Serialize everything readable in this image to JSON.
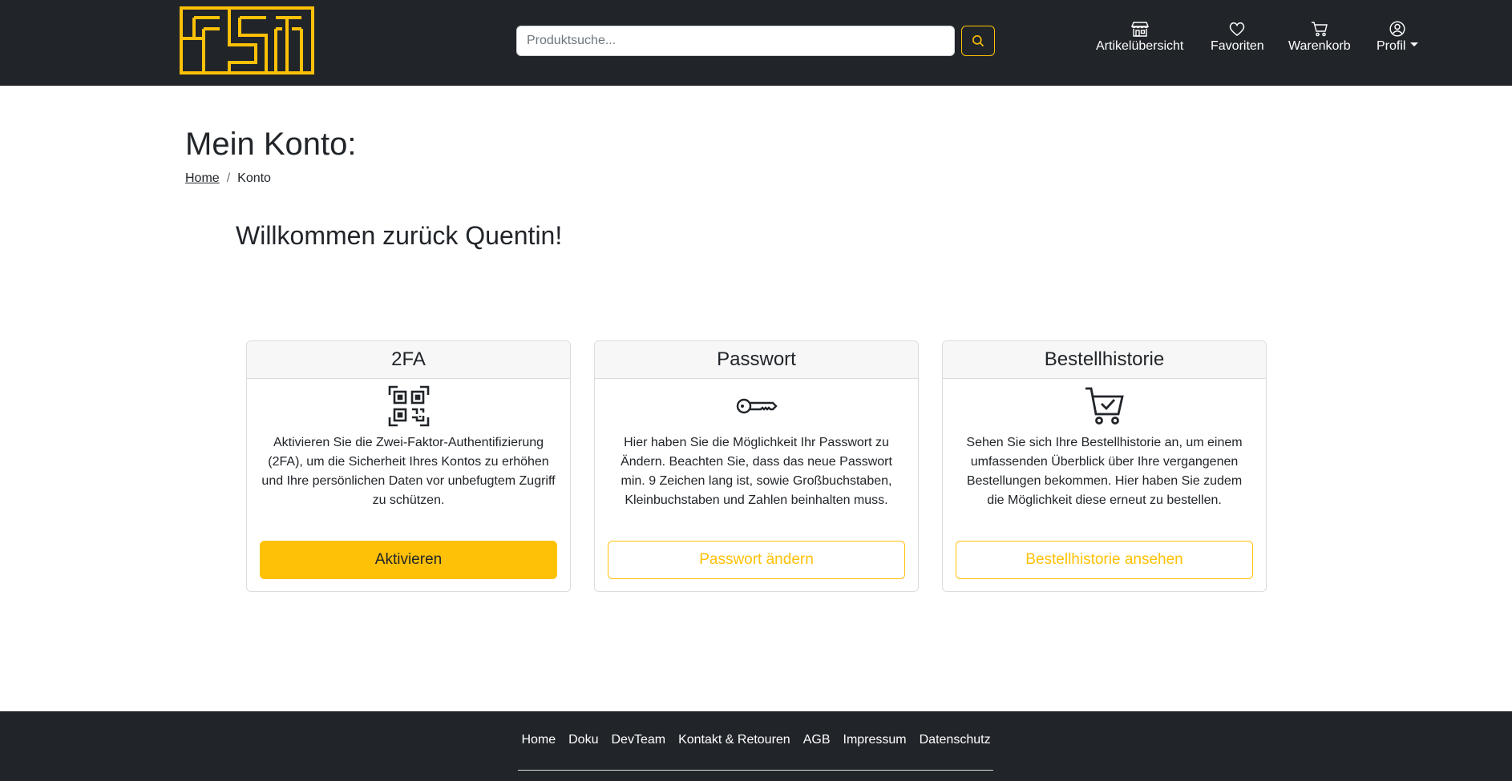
{
  "colors": {
    "accent": "#ffc107",
    "navbar_bg": "#212529",
    "text": "#212529"
  },
  "header": {
    "logo_text": "FST",
    "search": {
      "placeholder": "Produktsuche..."
    },
    "nav": [
      {
        "label": "Artikelübersicht",
        "icon": "store-icon"
      },
      {
        "label": "Favoriten",
        "icon": "heart-icon"
      },
      {
        "label": "Warenkorb",
        "icon": "cart-icon"
      },
      {
        "label": "Profil",
        "icon": "user-circle-icon"
      }
    ]
  },
  "main": {
    "title": "Mein Konto:",
    "breadcrumb": {
      "home": "Home",
      "separator": "/",
      "current": "Konto"
    },
    "welcome": "Willkommen zurück Quentin!",
    "cards": [
      {
        "title": "2FA",
        "icon": "qr-code-icon",
        "text": "Aktivieren Sie die Zwei-Faktor-Authentifizierung (2FA), um die Sicherheit Ihres Kontos zu erhöhen und Ihre persönlichen Daten vor unbefugtem Zugriff zu schützen.",
        "button": "Aktivieren"
      },
      {
        "title": "Passwort",
        "icon": "key-icon",
        "text": "Hier haben Sie die Möglichkeit Ihr Passwort zu Ändern. Beachten Sie, dass das neue Passwort min. 9 Zeichen lang ist, sowie Großbuchstaben, Kleinbuchstaben und Zahlen beinhalten muss.",
        "button": "Passwort ändern"
      },
      {
        "title": "Bestellhistorie",
        "icon": "cart-check-icon",
        "text": "Sehen Sie sich Ihre Bestellhistorie an, um einem umfassenden Überblick über Ihre vergangenen Bestellungen bekommen. Hier haben Sie zudem die Möglichkeit diese erneut zu bestellen.",
        "button": "Bestellhistorie ansehen"
      }
    ]
  },
  "footer": {
    "links": [
      "Home",
      "Doku",
      "DevTeam",
      "Kontakt & Retouren",
      "AGB",
      "Impressum",
      "Datenschutz"
    ]
  }
}
